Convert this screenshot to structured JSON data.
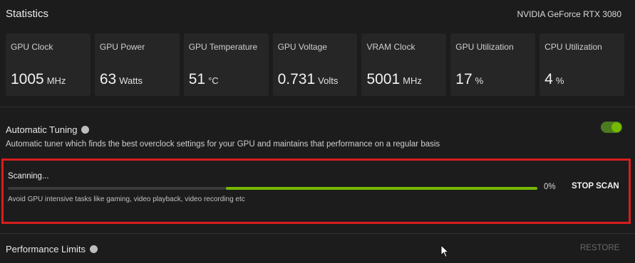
{
  "header": {
    "title": "Statistics",
    "gpu_name": "NVIDIA GeForce RTX 3080"
  },
  "stats": [
    {
      "label": "GPU Clock",
      "value": "1005",
      "unit": "MHz"
    },
    {
      "label": "GPU Power",
      "value": "63",
      "unit": "Watts"
    },
    {
      "label": "GPU Temperature",
      "value": "51",
      "unit": "°C"
    },
    {
      "label": "GPU Voltage",
      "value": "0.731",
      "unit": "Volts"
    },
    {
      "label": "VRAM Clock",
      "value": "5001",
      "unit": "MHz"
    },
    {
      "label": "GPU Utilization",
      "value": "17",
      "unit": "%"
    },
    {
      "label": "CPU Utilization",
      "value": "4",
      "unit": "%"
    }
  ],
  "automatic_tuning": {
    "title": "Automatic Tuning",
    "description": "Automatic tuner which finds the best overclock settings for your GPU and maintains that performance on a regular basis",
    "enabled": true
  },
  "scan": {
    "title": "Scanning...",
    "percent_label": "0%",
    "stop_label": "STOP SCAN",
    "note": "Avoid GPU intensive tasks like gaming, video playback, video recording etc"
  },
  "performance_limits": {
    "title": "Performance Limits",
    "restore_label": "RESTORE"
  },
  "colors": {
    "accent": "#76b900",
    "highlight_border": "#d81d1d"
  }
}
